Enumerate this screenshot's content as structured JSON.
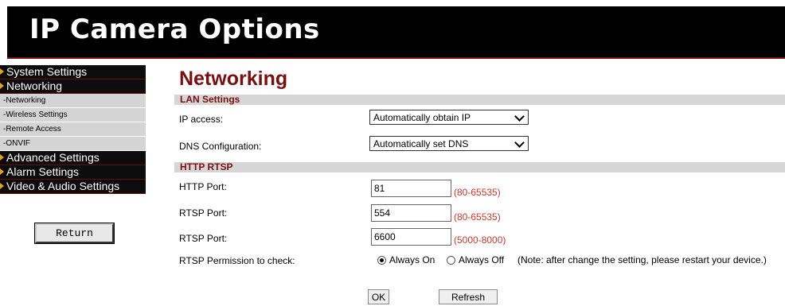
{
  "header": {
    "title": "IP Camera Options"
  },
  "sidebar": {
    "menus": [
      {
        "label": "System Settings"
      },
      {
        "label": "Networking"
      }
    ],
    "subitems": [
      {
        "label": "-Networking"
      },
      {
        "label": "-Wireless Settings"
      },
      {
        "label": "-Remote Access"
      },
      {
        "label": "-ONVIF"
      }
    ],
    "menus_after": [
      {
        "label": "Advanced Settings"
      },
      {
        "label": "Alarm Settings"
      },
      {
        "label": "Video & Audio Settings"
      }
    ],
    "return_label": "Return"
  },
  "main": {
    "title": "Networking",
    "lan": {
      "heading": "LAN Settings",
      "ip_access_label": "IP access:",
      "ip_access_value": "Automatically obtain IP",
      "dns_label": "DNS Configuration:",
      "dns_value": "Automatically set DNS"
    },
    "http": {
      "heading": "HTTP RTSP",
      "http_port_label": "HTTP Port:",
      "http_port_value": "81",
      "http_port_range": "(80-65535)",
      "rtsp_port_label": "RTSP Port:",
      "rtsp_port_value": "554",
      "rtsp_port_range": "(80-65535)",
      "rtsp_port2_label": "RTSP Port:",
      "rtsp_port2_value": "6600",
      "rtsp_port2_range": "(5000-8000)",
      "permission_label": "RTSP Permission to check:",
      "option_on": "Always On",
      "option_off": "Always Off",
      "note": "(Note: after change the setting, please restart your device.)",
      "selected": "Always On"
    },
    "buttons": {
      "ok": "OK",
      "refresh": "Refresh"
    }
  },
  "colors": {
    "accent": "#7a0f0f",
    "arrow": "#e8a21a",
    "range": "#c0392b"
  }
}
